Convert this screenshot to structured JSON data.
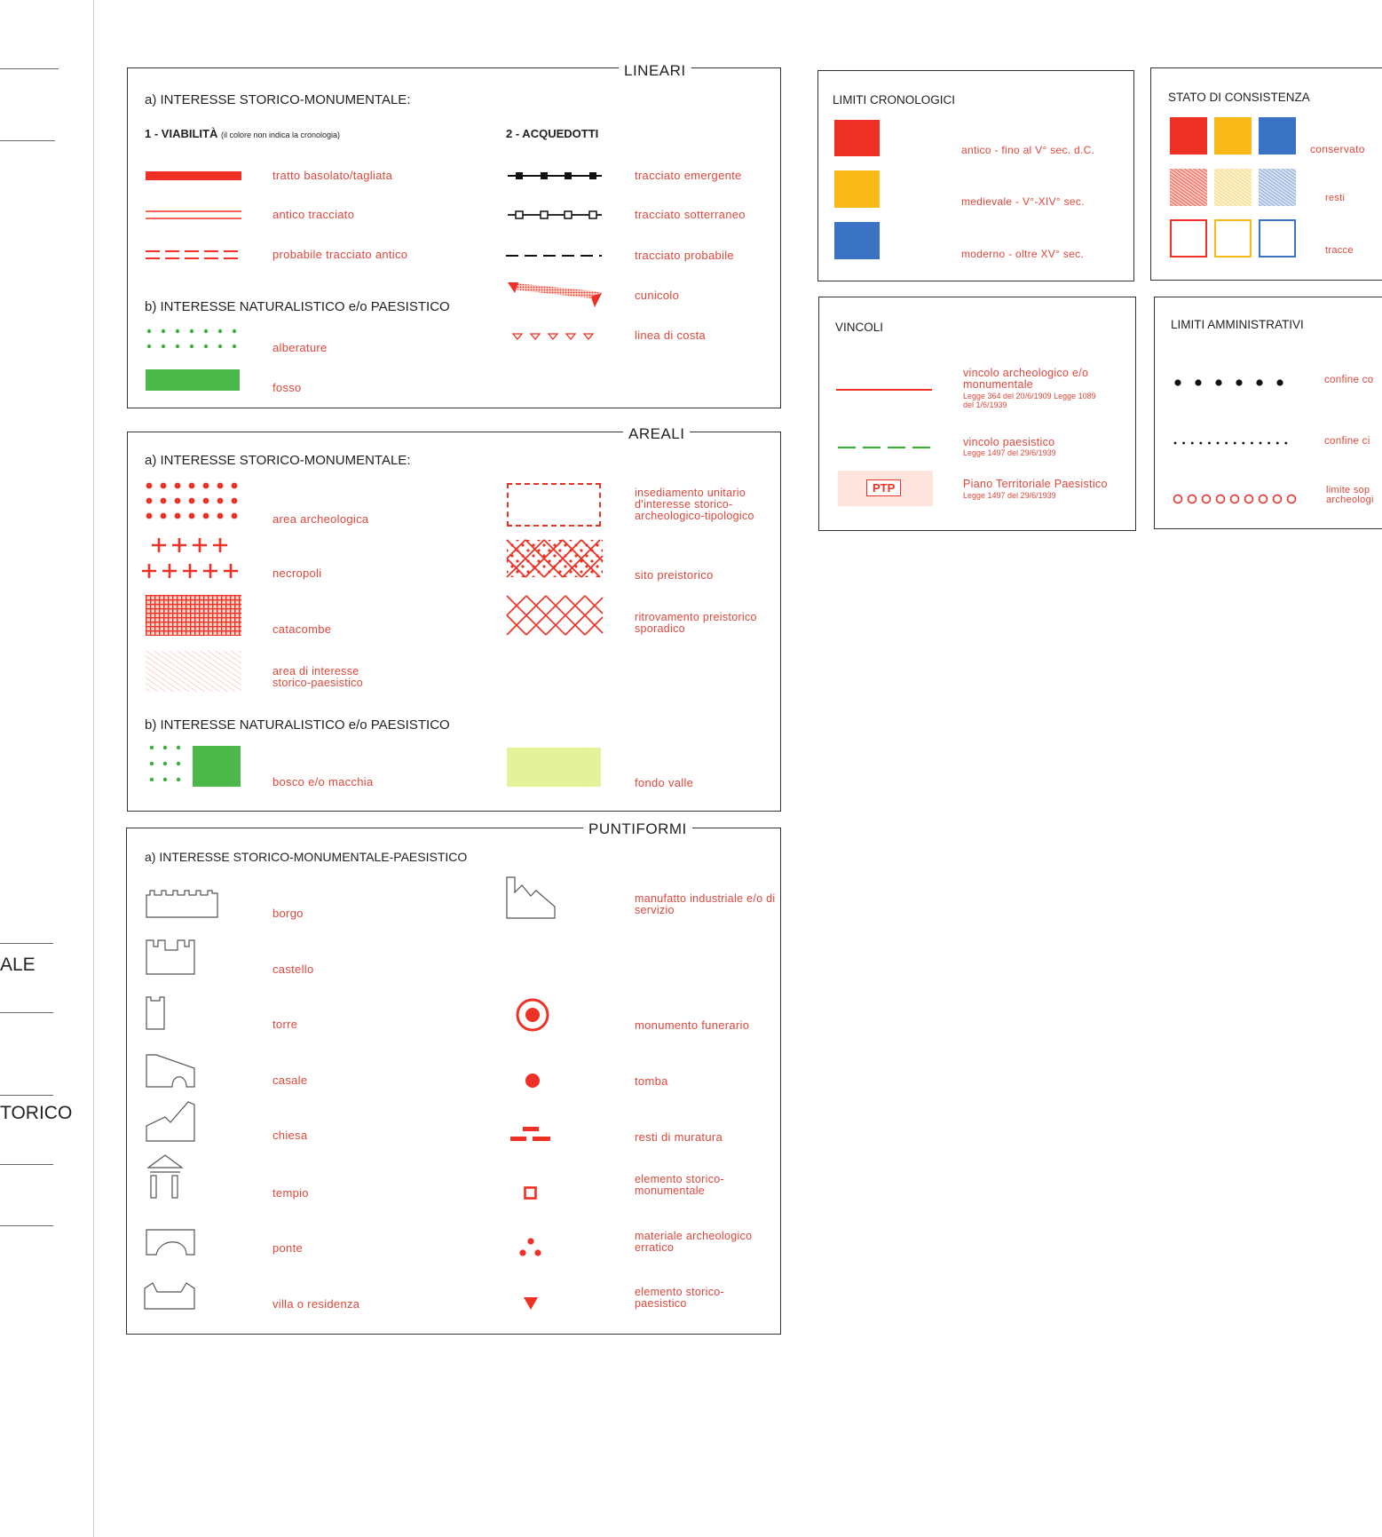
{
  "sidebar": {
    "item_1": "ALE",
    "item_2": "TORICO"
  },
  "lineari": {
    "title": "LINEARI",
    "section_a": "a) INTERESSE STORICO-MONUMENTALE:",
    "viabilita": "1 - VIABILITÀ",
    "viabilita_note": "(il colore non indica la cronologia)",
    "acquedotti": "2 - ACQUEDOTTI",
    "items_left": [
      "tratto basolato/tagliata",
      "antico tracciato",
      "probabile tracciato antico"
    ],
    "items_right": [
      "tracciato emergente",
      "tracciato sotterraneo",
      "tracciato probabile",
      "cunicolo",
      "linea di costa"
    ],
    "section_b": "b) INTERESSE NATURALISTICO e/o PAESISTICO",
    "items_b": [
      "alberature",
      "fosso"
    ]
  },
  "areali": {
    "title": "AREALI",
    "section_a": "a) INTERESSE STORICO-MONUMENTALE:",
    "items_left": [
      "area archeologica",
      "necropoli",
      "catacombe",
      "area di interesse storico-paesistico"
    ],
    "items_right": [
      "insediamento unitario d'interesse storico-archeologico-tipologico",
      "sito preistorico",
      "ritrovamento preistorico sporadico"
    ],
    "section_b": "b) INTERESSE NATURALISTICO e/o PAESISTICO",
    "items_b": [
      "bosco e/o macchia",
      "fondo valle"
    ]
  },
  "puntiformi": {
    "title": "PUNTIFORMI",
    "section_a": "a) INTERESSE STORICO-MONUMENTALE-PAESISTICO",
    "items_left": [
      "borgo",
      "castello",
      "torre",
      "casale",
      "chiesa",
      "tempio",
      "ponte",
      "villa o residenza"
    ],
    "items_right": [
      "manufatto industriale e/o di servizio",
      "monumento funerario",
      "tomba",
      "resti di muratura",
      "elemento storico-monumentale",
      "materiale archeologico erratico",
      "elemento storico-paesistico"
    ]
  },
  "limiti_cronologici": {
    "title": "LIMITI CRONOLOGICI",
    "items": [
      "antico - fino al V° sec. d.C.",
      "medievale - V°-XIV° sec.",
      "moderno - oltre XV° sec."
    ]
  },
  "stato_consistenza": {
    "title": "STATO DI CONSISTENZA",
    "items": [
      "conservato",
      "resti",
      "tracce"
    ]
  },
  "vincoli": {
    "title": "VINCOLI",
    "items": [
      {
        "label": "vincolo archeologico e/o monumentale",
        "law": "Legge 364 del 20/6/1909 Legge 1089 del 1/6/1939"
      },
      {
        "label": "vincolo paesistico",
        "law": "Legge 1497 del 29/6/1939"
      },
      {
        "label": "Piano Territoriale Paesistico",
        "law": "Legge 1497 del 29/6/1939"
      }
    ],
    "ptp_badge": "PTP"
  },
  "limiti_amministrativi": {
    "title": "LIMITI AMMINISTRATIVI",
    "items": [
      "confine co",
      "confine ci",
      "limite sop archeologi"
    ]
  },
  "colors": {
    "red": "#ee3124",
    "yellow": "#f9b918",
    "blue": "#3a72c4",
    "green": "#4cb84a",
    "pale_green": "#e4f39a"
  }
}
